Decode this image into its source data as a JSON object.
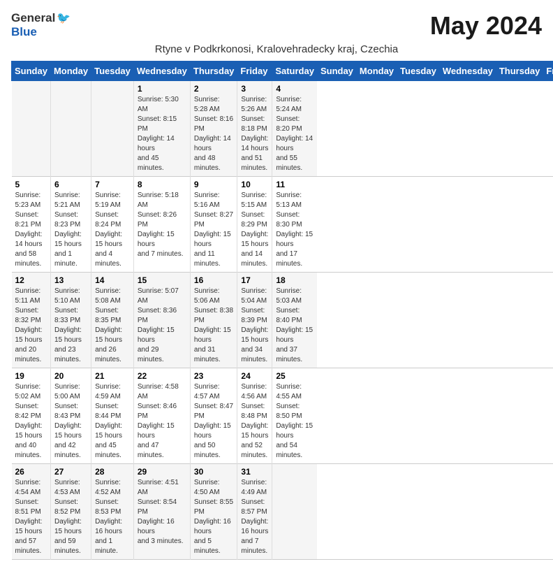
{
  "header": {
    "logo_general": "General",
    "logo_blue": "Blue",
    "month_title": "May 2024",
    "subtitle": "Rtyne v Podkrkonosi, Kralovehradecky kraj, Czechia"
  },
  "calendar": {
    "days_of_week": [
      "Sunday",
      "Monday",
      "Tuesday",
      "Wednesday",
      "Thursday",
      "Friday",
      "Saturday"
    ],
    "weeks": [
      [
        {
          "day": "",
          "info": ""
        },
        {
          "day": "",
          "info": ""
        },
        {
          "day": "",
          "info": ""
        },
        {
          "day": "1",
          "info": "Sunrise: 5:30 AM\nSunset: 8:15 PM\nDaylight: 14 hours\nand 45 minutes."
        },
        {
          "day": "2",
          "info": "Sunrise: 5:28 AM\nSunset: 8:16 PM\nDaylight: 14 hours\nand 48 minutes."
        },
        {
          "day": "3",
          "info": "Sunrise: 5:26 AM\nSunset: 8:18 PM\nDaylight: 14 hours\nand 51 minutes."
        },
        {
          "day": "4",
          "info": "Sunrise: 5:24 AM\nSunset: 8:20 PM\nDaylight: 14 hours\nand 55 minutes."
        }
      ],
      [
        {
          "day": "5",
          "info": "Sunrise: 5:23 AM\nSunset: 8:21 PM\nDaylight: 14 hours\nand 58 minutes."
        },
        {
          "day": "6",
          "info": "Sunrise: 5:21 AM\nSunset: 8:23 PM\nDaylight: 15 hours\nand 1 minute."
        },
        {
          "day": "7",
          "info": "Sunrise: 5:19 AM\nSunset: 8:24 PM\nDaylight: 15 hours\nand 4 minutes."
        },
        {
          "day": "8",
          "info": "Sunrise: 5:18 AM\nSunset: 8:26 PM\nDaylight: 15 hours\nand 7 minutes."
        },
        {
          "day": "9",
          "info": "Sunrise: 5:16 AM\nSunset: 8:27 PM\nDaylight: 15 hours\nand 11 minutes."
        },
        {
          "day": "10",
          "info": "Sunrise: 5:15 AM\nSunset: 8:29 PM\nDaylight: 15 hours\nand 14 minutes."
        },
        {
          "day": "11",
          "info": "Sunrise: 5:13 AM\nSunset: 8:30 PM\nDaylight: 15 hours\nand 17 minutes."
        }
      ],
      [
        {
          "day": "12",
          "info": "Sunrise: 5:11 AM\nSunset: 8:32 PM\nDaylight: 15 hours\nand 20 minutes."
        },
        {
          "day": "13",
          "info": "Sunrise: 5:10 AM\nSunset: 8:33 PM\nDaylight: 15 hours\nand 23 minutes."
        },
        {
          "day": "14",
          "info": "Sunrise: 5:08 AM\nSunset: 8:35 PM\nDaylight: 15 hours\nand 26 minutes."
        },
        {
          "day": "15",
          "info": "Sunrise: 5:07 AM\nSunset: 8:36 PM\nDaylight: 15 hours\nand 29 minutes."
        },
        {
          "day": "16",
          "info": "Sunrise: 5:06 AM\nSunset: 8:38 PM\nDaylight: 15 hours\nand 31 minutes."
        },
        {
          "day": "17",
          "info": "Sunrise: 5:04 AM\nSunset: 8:39 PM\nDaylight: 15 hours\nand 34 minutes."
        },
        {
          "day": "18",
          "info": "Sunrise: 5:03 AM\nSunset: 8:40 PM\nDaylight: 15 hours\nand 37 minutes."
        }
      ],
      [
        {
          "day": "19",
          "info": "Sunrise: 5:02 AM\nSunset: 8:42 PM\nDaylight: 15 hours\nand 40 minutes."
        },
        {
          "day": "20",
          "info": "Sunrise: 5:00 AM\nSunset: 8:43 PM\nDaylight: 15 hours\nand 42 minutes."
        },
        {
          "day": "21",
          "info": "Sunrise: 4:59 AM\nSunset: 8:44 PM\nDaylight: 15 hours\nand 45 minutes."
        },
        {
          "day": "22",
          "info": "Sunrise: 4:58 AM\nSunset: 8:46 PM\nDaylight: 15 hours\nand 47 minutes."
        },
        {
          "day": "23",
          "info": "Sunrise: 4:57 AM\nSunset: 8:47 PM\nDaylight: 15 hours\nand 50 minutes."
        },
        {
          "day": "24",
          "info": "Sunrise: 4:56 AM\nSunset: 8:48 PM\nDaylight: 15 hours\nand 52 minutes."
        },
        {
          "day": "25",
          "info": "Sunrise: 4:55 AM\nSunset: 8:50 PM\nDaylight: 15 hours\nand 54 minutes."
        }
      ],
      [
        {
          "day": "26",
          "info": "Sunrise: 4:54 AM\nSunset: 8:51 PM\nDaylight: 15 hours\nand 57 minutes."
        },
        {
          "day": "27",
          "info": "Sunrise: 4:53 AM\nSunset: 8:52 PM\nDaylight: 15 hours\nand 59 minutes."
        },
        {
          "day": "28",
          "info": "Sunrise: 4:52 AM\nSunset: 8:53 PM\nDaylight: 16 hours\nand 1 minute."
        },
        {
          "day": "29",
          "info": "Sunrise: 4:51 AM\nSunset: 8:54 PM\nDaylight: 16 hours\nand 3 minutes."
        },
        {
          "day": "30",
          "info": "Sunrise: 4:50 AM\nSunset: 8:55 PM\nDaylight: 16 hours\nand 5 minutes."
        },
        {
          "day": "31",
          "info": "Sunrise: 4:49 AM\nSunset: 8:57 PM\nDaylight: 16 hours\nand 7 minutes."
        },
        {
          "day": "",
          "info": ""
        }
      ]
    ]
  }
}
